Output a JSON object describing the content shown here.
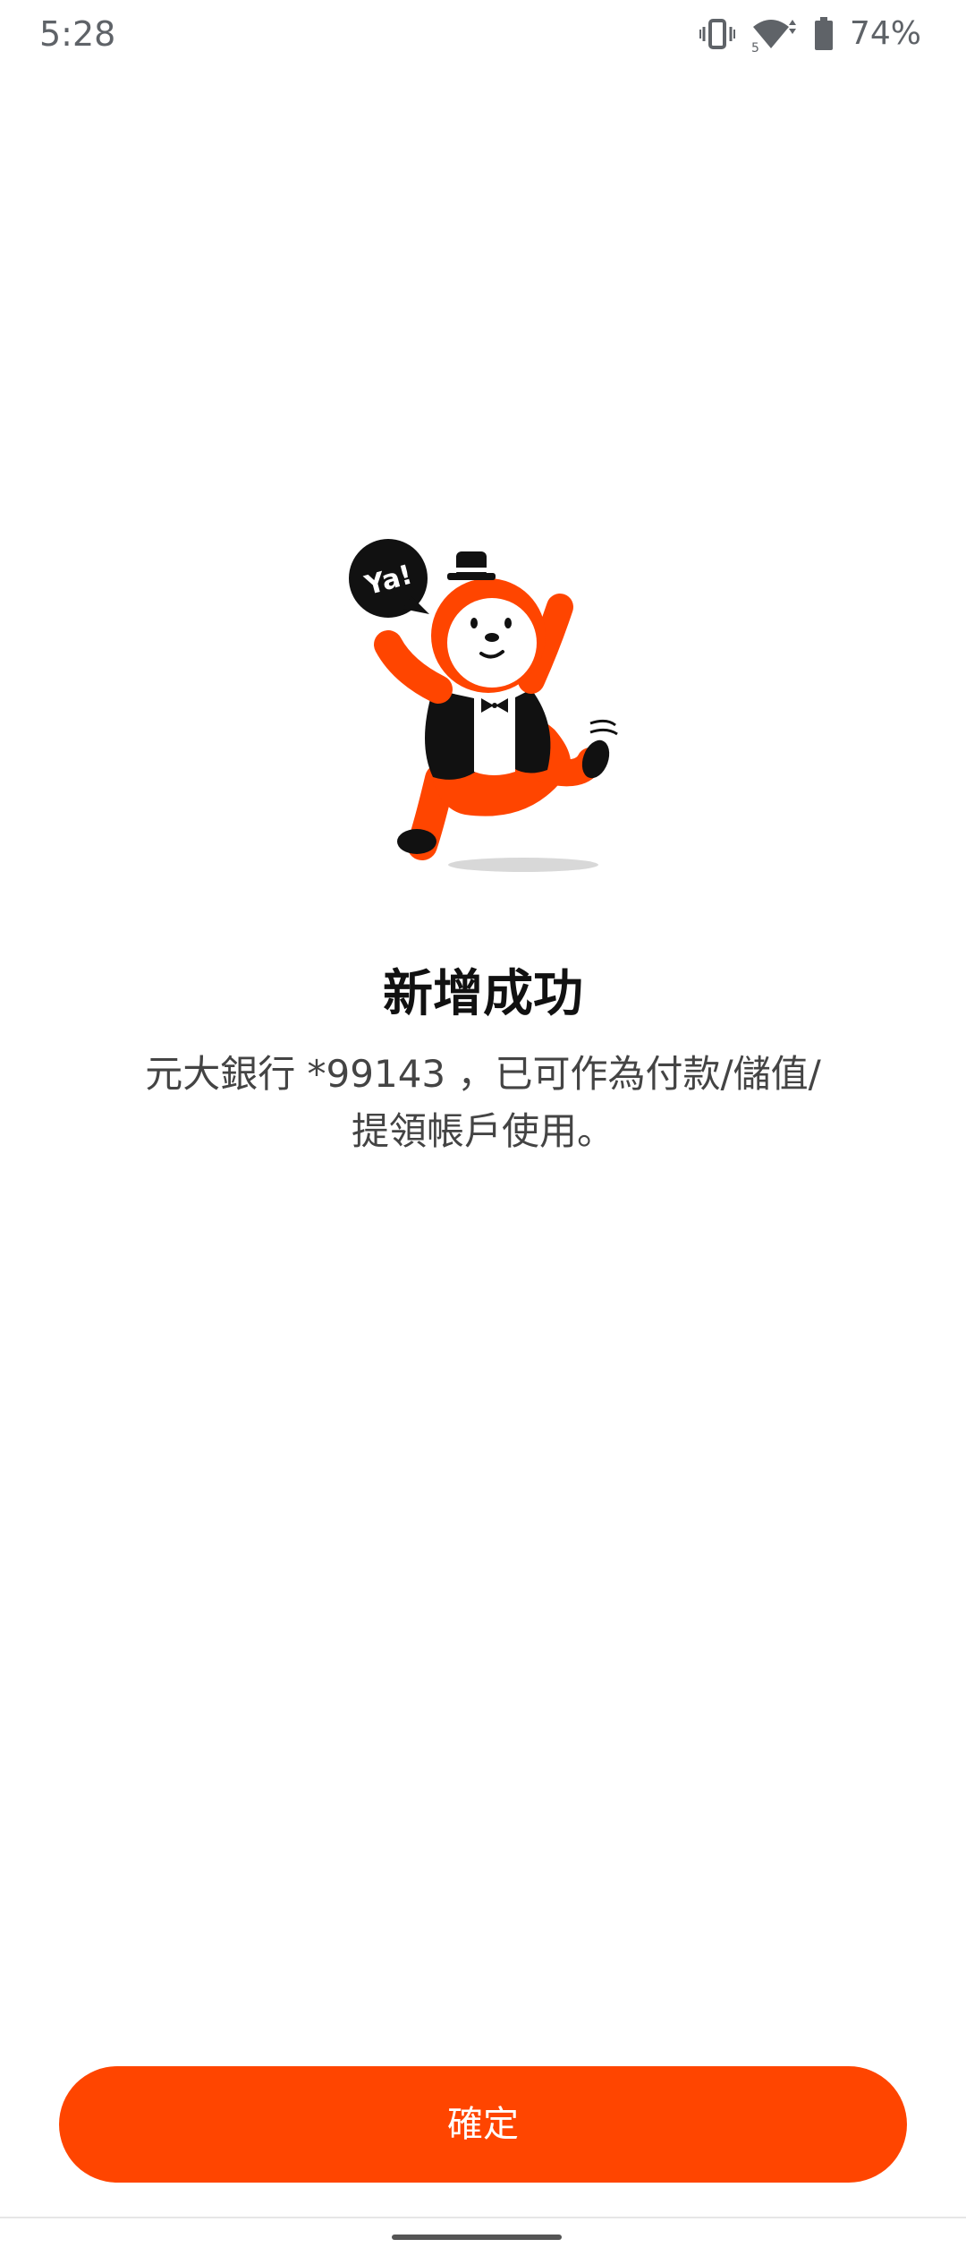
{
  "status_bar": {
    "time": "5:28",
    "icons": [
      "vibrate-icon",
      "wifi-icon",
      "battery-icon"
    ],
    "battery_percent": "74%"
  },
  "illustration": {
    "speech_text": "Ya!"
  },
  "result": {
    "title": "新增成功",
    "line1": "元大銀行 *99143 ，已可作為付款/儲值/",
    "line2": "提領帳戶使用。"
  },
  "actions": {
    "confirm_label": "確定"
  },
  "colors": {
    "accent": "#ff4500",
    "title": "#111111",
    "body_text": "#444444"
  }
}
